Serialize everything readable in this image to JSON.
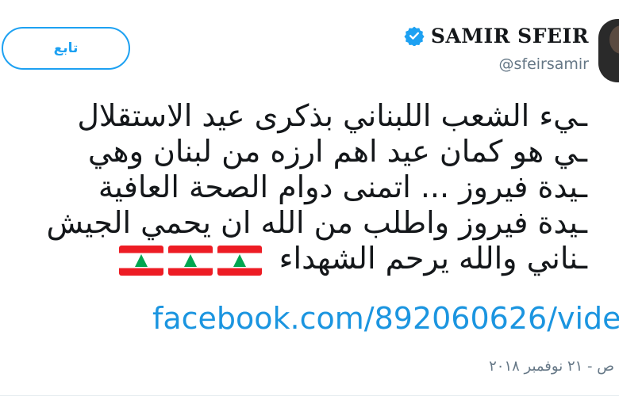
{
  "follow_button": {
    "label": "تابع"
  },
  "user": {
    "display_name": "SAMIR SFEIR",
    "handle": "@sfeirsamir",
    "verified": true
  },
  "tweet": {
    "lines": [
      "ـيء الشعب اللبناني بذكرى عيد الاستقلال",
      "ـي هو كمان عيد اهم ارزه من لبنان وهي",
      "ـيدة فيروز ... اتمنى دوام الصحة العافية",
      "ـيدة فيروز واطلب من الله ان يحمي الجيش",
      "ـناني والله يرحم الشهداء"
    ],
    "emoji": [
      "lebanon-flag",
      "lebanon-flag",
      "lebanon-flag"
    ],
    "link": "facebook.com/892060626/vide",
    "timestamp": "ص - ٢١ نوفمبر ٢٠١٨"
  },
  "colors": {
    "accent": "#1da1f2",
    "link": "#1b95e0",
    "secondary_text": "#657786",
    "primary_text": "#14171a"
  }
}
